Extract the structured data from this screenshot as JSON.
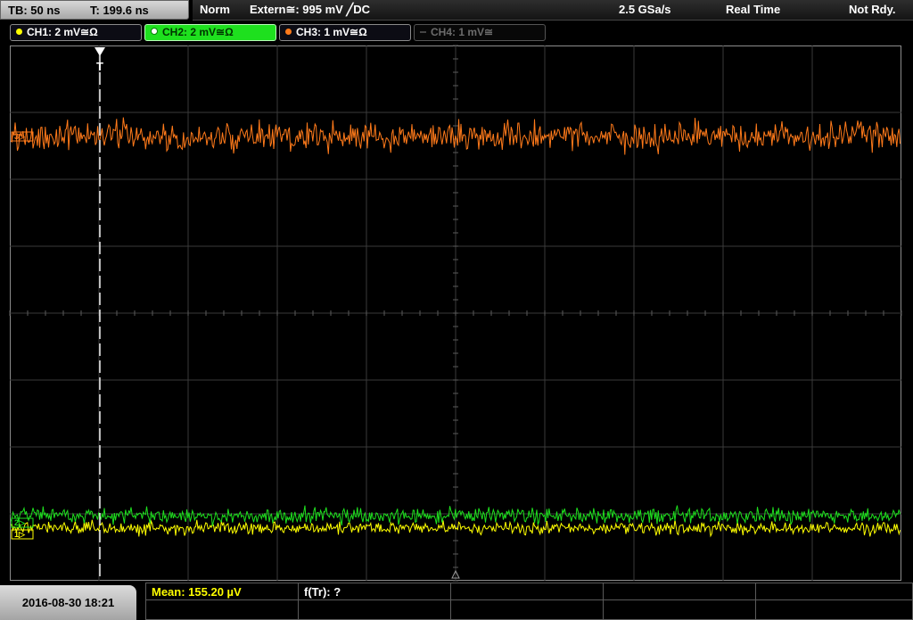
{
  "timebase": {
    "tb_label": "TB: 50 ns",
    "trigger_time_label": "T: 199.6 ns"
  },
  "status": {
    "mode": "Norm",
    "trigger_source": "Extern≅: 995 mV ╱DC",
    "sample_rate": "2.5 GSa/s",
    "acq_mode": "Real Time",
    "ready_state": "Not Rdy."
  },
  "channels": [
    {
      "label": "CH1: 2 mV≅Ω",
      "color": "#ffff00",
      "state": "on"
    },
    {
      "label": "CH2: 2 mV≅Ω",
      "color": "#1ee01e",
      "state": "selected"
    },
    {
      "label": "CH3: 1 mV≅Ω",
      "color": "#ff7a1a",
      "state": "on"
    },
    {
      "label": "CH4: 1 mV≅",
      "color": "#6c6c6c",
      "state": "off"
    }
  ],
  "trigger_marker": "T",
  "ref_markers": {
    "ch3": "3▷",
    "ch1": "1▷",
    "ch2": "2▷"
  },
  "measurements": {
    "mean": "Mean: 155.20 µV",
    "freq": "f(Tr): ?"
  },
  "timestamp": "2016-08-30 18:21",
  "colors": {
    "grid": "#8c8c8c",
    "ch1": "#ffff00",
    "ch2": "#1ee01e",
    "ch3": "#ff7a1a",
    "meas_text": "#ffff00"
  }
}
